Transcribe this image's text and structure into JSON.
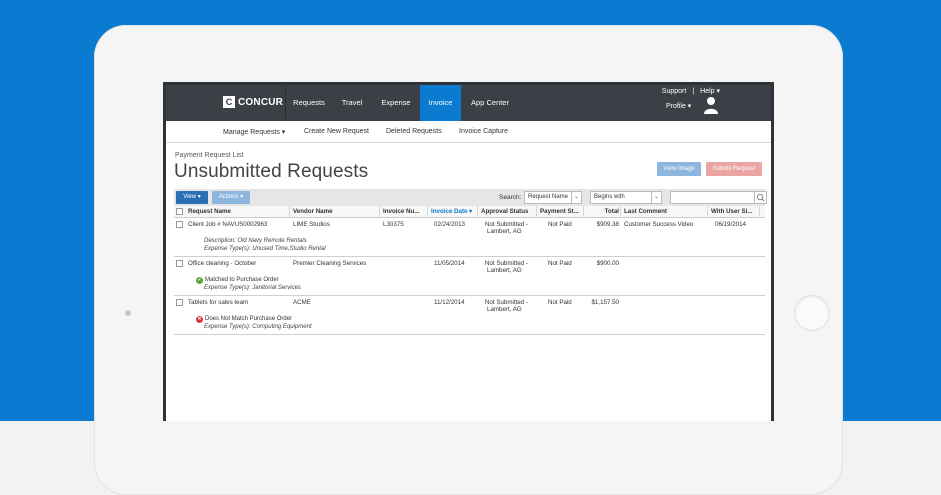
{
  "nav": {
    "logo": "CONCUR",
    "items": [
      {
        "label": "Requests"
      },
      {
        "label": "Travel"
      },
      {
        "label": "Expense"
      },
      {
        "label": "Invoice"
      },
      {
        "label": "App Center"
      }
    ],
    "support": "Support",
    "separator": "|",
    "help": "Help ▾",
    "profile": "Profile ▾",
    "active_color": "#0a7bd0"
  },
  "subnav": {
    "items": [
      {
        "label": "Manage Requests ▾"
      },
      {
        "label": "Create New Request"
      },
      {
        "label": "Deleted Requests"
      },
      {
        "label": "Invoice Capture"
      }
    ]
  },
  "page": {
    "breadcrumb": "Payment Request List",
    "title": "Unsubmitted Requests",
    "view_image": "View Image",
    "submit_request": "Submit Request"
  },
  "toolbar": {
    "view": "View ▾",
    "actions": "Actions ▾",
    "search_label": "Search:",
    "search_field": "Request Name",
    "match_mode": "Begins with",
    "search_value": ""
  },
  "table": {
    "columns": [
      {
        "label": "Request Name"
      },
      {
        "label": "Vendor Name"
      },
      {
        "label": "Invoice Nu..."
      },
      {
        "label": "Invoice Date ▾"
      },
      {
        "label": "Approval Status"
      },
      {
        "label": "Payment St..."
      },
      {
        "label": "Total"
      },
      {
        "label": "Last Comment"
      },
      {
        "label": "With User Si..."
      }
    ],
    "rows": [
      {
        "name": "Client Job # NAVUS0002963",
        "vendor": "LIME Studios",
        "invoice_no": "L30375",
        "date": "02/24/2013",
        "approval_1": "Not Submitted -",
        "approval_2": "Lambert, AG",
        "payment": "Not Paid",
        "total": "$909.38",
        "comment": "Customer Success Video",
        "with_user": "06/19/2014",
        "detail_1": "Description:  Old Navy Remote Rentals",
        "detail_2": "Expense Type(s):  Unused Time,Studio Rental"
      },
      {
        "name": "Office cleaning - October",
        "vendor": "Premier Cleaning Services",
        "invoice_no": "",
        "date": "11/05/2014",
        "approval_1": "Not Submitted -",
        "approval_2": "Lambert, AG",
        "payment": "Not Paid",
        "total": "$900.00",
        "comment": "",
        "with_user": "",
        "status": "Matched to Purchase Order",
        "detail_2": "Expense Type(s):  Janitorial Services"
      },
      {
        "name": "Tablets for sales team",
        "vendor": "ACME",
        "invoice_no": "",
        "date": "11/12/2014",
        "approval_1": "Not Submitted -",
        "approval_2": "Lambert, AG",
        "payment": "Not Paid",
        "total": "$1,157.50",
        "comment": "",
        "with_user": "",
        "status": "Does Not Match Purchase Order",
        "detail_2": "Expense Type(s):  Computing Equipment"
      }
    ]
  }
}
